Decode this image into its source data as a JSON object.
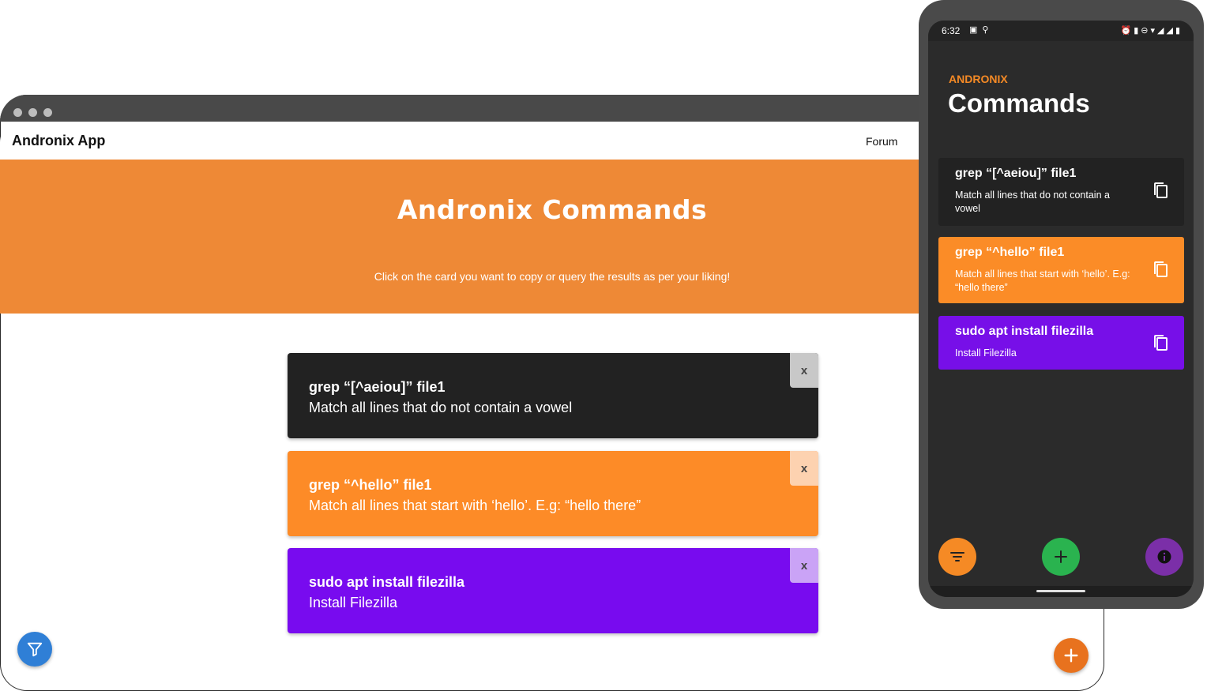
{
  "browser": {
    "brand": "Andronix App",
    "nav_link": "Forum",
    "hero": {
      "title": "Andronix Commands",
      "subtitle": "Click on the card you want to copy or query the results as per your liking!"
    },
    "cards": [
      {
        "command": "grep “[^aeiou]” file1",
        "description": "Match all lines that do not contain a vowel",
        "close": "x",
        "bg": "#222222",
        "close_bg": "#c8c8c8"
      },
      {
        "command": "grep “^hello” file1",
        "description": "Match all lines that start with ‘hello’. E.g: “hello there”",
        "close": "x",
        "bg": "#fd8b27",
        "close_bg": "#fdd2b0"
      },
      {
        "command": "sudo apt install filezilla",
        "description": "Install Filezilla",
        "close": "x",
        "bg": "#780bef",
        "close_bg": "#caa3f6"
      }
    ],
    "fabs": {
      "filter_icon": "filter-funnel-icon",
      "add_icon": "plus-icon",
      "filter_color": "#2f7fd6",
      "add_color": "#e8721e"
    }
  },
  "phone": {
    "status": {
      "time": "6:32"
    },
    "app_label": "ANDRONIX",
    "app_title": "Commands",
    "cards": [
      {
        "command": "grep “[^aeiou]” file1",
        "description": "Match all lines that do not contain a vowel",
        "bg": "#222222"
      },
      {
        "command": "grep “^hello” file1",
        "description": "Match all lines that start with ‘hello’. E.g: “hello there”",
        "bg": "#fb8c27"
      },
      {
        "command": "sudo apt install filezilla",
        "description": "Install Filezilla",
        "bg": "#770fe8"
      }
    ],
    "fabs": {
      "filter_color": "#f58a25",
      "add_color": "#2ab34f",
      "info_color": "#7b2fa8"
    }
  }
}
